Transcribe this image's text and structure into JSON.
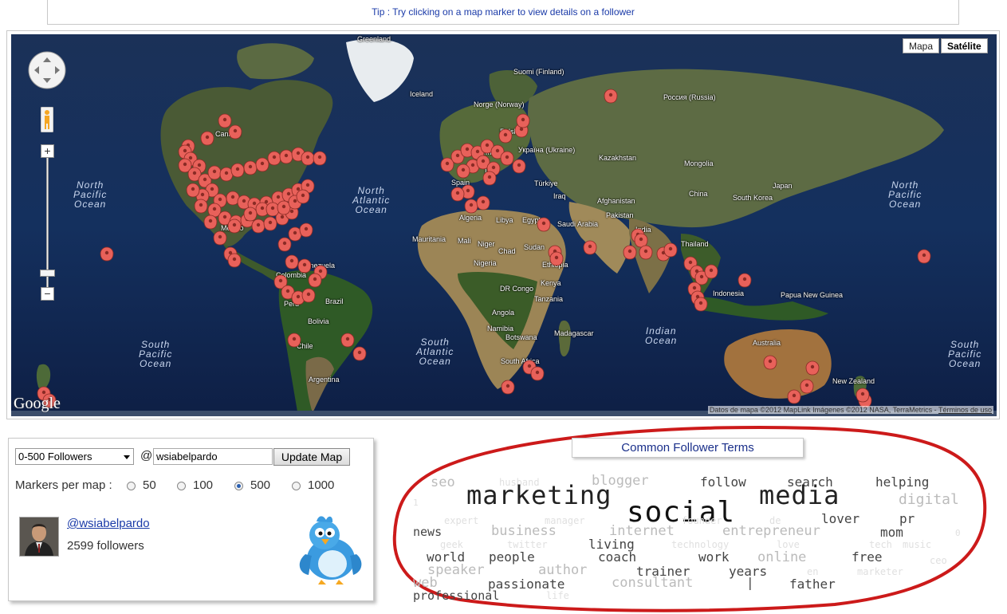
{
  "tip": "Tip : Try clicking on a map marker to view details on a follower",
  "map": {
    "type_buttons": [
      "Mapa",
      "Satélite"
    ],
    "active_type": "Satélite",
    "zoom_in": "+",
    "zoom_out": "−",
    "google_logo": "Google",
    "attribution": "Datos de mapa ©2012 MapLink Imágenes ©2012 NASA, TerraMetrics -",
    "terms_link": "Términos de uso",
    "marker_color": "#e8615a",
    "labels": [
      "Greenland",
      "Iceland",
      "Suomi (Finland)",
      "Norge (Norway)",
      "Polska",
      "Germany",
      "Україна (Ukraine)",
      "Spain",
      "Italy",
      "Türkiye",
      "Iraq",
      "Afghanistan",
      "Pakistan",
      "India",
      "Kazakhstan",
      "Mongolia",
      "Россия (Russia)",
      "China",
      "South Korea",
      "Japan",
      "Thailand",
      "Indonesia",
      "Papua New Guinea",
      "Australia",
      "New Zealand",
      "Canada",
      "México",
      "Colombia",
      "Venezuela",
      "Perú",
      "Brazil",
      "Bolivia",
      "Chile",
      "Argentina",
      "Algeria",
      "Libya",
      "Egypt",
      "Saudi Arabia",
      "Mauritania",
      "Mali",
      "Niger",
      "Chad",
      "Sudan",
      "Ethiopia",
      "Nigeria",
      "DR Congo",
      "Kenya",
      "Tanzania",
      "Angola",
      "Namibia",
      "Botswana",
      "South Africa",
      "Madagascar"
    ],
    "oceans": [
      "North Pacific Ocean",
      "North Atlantic Ocean",
      "South Pacific Ocean",
      "South Atlantic Ocean",
      "Indian Ocean",
      "North Pacific Ocean",
      "South Pacific Ocean"
    ]
  },
  "controls": {
    "follower_range": "0-500 Followers",
    "at_symbol": "@",
    "handle": "wsiabelpardo",
    "update_button": "Update Map",
    "markers_label": "Markers per map :",
    "marker_options": [
      "50",
      "100",
      "500",
      "1000"
    ],
    "marker_selected": "500",
    "username": "@wsiabelpardo",
    "followers_text": "2599 followers"
  },
  "terms": {
    "title": "Common Follower Terms",
    "ellipse_color": "#cc1a1a",
    "words": [
      {
        "t": "seo",
        "c": "#bbbbbb",
        "s": 17
      },
      {
        "t": "husband",
        "c": "#e0e0e0",
        "s": 12
      },
      {
        "t": "blogger",
        "c": "#bbbbbb",
        "s": 17
      },
      {
        "t": "follow",
        "c": "#444444",
        "s": 16
      },
      {
        "t": "search",
        "c": "#444444",
        "s": 16
      },
      {
        "t": "helping",
        "c": "#444444",
        "s": 16
      },
      {
        "t": "1",
        "c": "#e0e0e0",
        "s": 11
      },
      {
        "t": "marketing",
        "c": "#222222",
        "s": 32
      },
      {
        "t": "social",
        "c": "#111111",
        "s": 36
      },
      {
        "t": "media",
        "c": "#222222",
        "s": 32
      },
      {
        "t": "digital",
        "c": "#bbbbbb",
        "s": 18
      },
      {
        "t": "expert",
        "c": "#e0e0e0",
        "s": 12
      },
      {
        "t": "manager",
        "c": "#e0e0e0",
        "s": 12
      },
      {
        "t": "founder",
        "c": "#e0e0e0",
        "s": 12
      },
      {
        "t": "de",
        "c": "#e0e0e0",
        "s": 12
      },
      {
        "t": "lover",
        "c": "#444444",
        "s": 16
      },
      {
        "t": "pr",
        "c": "#444444",
        "s": 16
      },
      {
        "t": "news",
        "c": "#444444",
        "s": 15
      },
      {
        "t": "business",
        "c": "#bbbbbb",
        "s": 17
      },
      {
        "t": "internet",
        "c": "#bbbbbb",
        "s": 17
      },
      {
        "t": "entrepreneur",
        "c": "#bbbbbb",
        "s": 17
      },
      {
        "t": "mom",
        "c": "#444444",
        "s": 16
      },
      {
        "t": "0",
        "c": "#e0e0e0",
        "s": 11
      },
      {
        "t": "geek",
        "c": "#e0e0e0",
        "s": 12
      },
      {
        "t": "twitter",
        "c": "#e0e0e0",
        "s": 12
      },
      {
        "t": "living",
        "c": "#444444",
        "s": 16
      },
      {
        "t": "technology",
        "c": "#e0e0e0",
        "s": 12
      },
      {
        "t": "love",
        "c": "#e0e0e0",
        "s": 12
      },
      {
        "t": "tech",
        "c": "#e0e0e0",
        "s": 12
      },
      {
        "t": "music",
        "c": "#e0e0e0",
        "s": 12
      },
      {
        "t": "world",
        "c": "#444444",
        "s": 16
      },
      {
        "t": "people",
        "c": "#444444",
        "s": 16
      },
      {
        "t": "coach",
        "c": "#444444",
        "s": 16
      },
      {
        "t": "work",
        "c": "#444444",
        "s": 16
      },
      {
        "t": "online",
        "c": "#bbbbbb",
        "s": 17
      },
      {
        "t": "free",
        "c": "#444444",
        "s": 16
      },
      {
        "t": "ceo",
        "c": "#e0e0e0",
        "s": 12
      },
      {
        "t": "speaker",
        "c": "#bbbbbb",
        "s": 17
      },
      {
        "t": "author",
        "c": "#bbbbbb",
        "s": 17
      },
      {
        "t": "trainer",
        "c": "#444444",
        "s": 16
      },
      {
        "t": "years",
        "c": "#444444",
        "s": 16
      },
      {
        "t": "en",
        "c": "#e0e0e0",
        "s": 12
      },
      {
        "t": "marketer",
        "c": "#e0e0e0",
        "s": 12
      },
      {
        "t": "web",
        "c": "#bbbbbb",
        "s": 17
      },
      {
        "t": "passionate",
        "c": "#444444",
        "s": 16
      },
      {
        "t": "consultant",
        "c": "#bbbbbb",
        "s": 17
      },
      {
        "t": "|",
        "c": "#444444",
        "s": 16
      },
      {
        "t": "father",
        "c": "#444444",
        "s": 16
      },
      {
        "t": "professional",
        "c": "#444444",
        "s": 15
      },
      {
        "t": "life",
        "c": "#e0e0e0",
        "s": 12
      }
    ]
  }
}
